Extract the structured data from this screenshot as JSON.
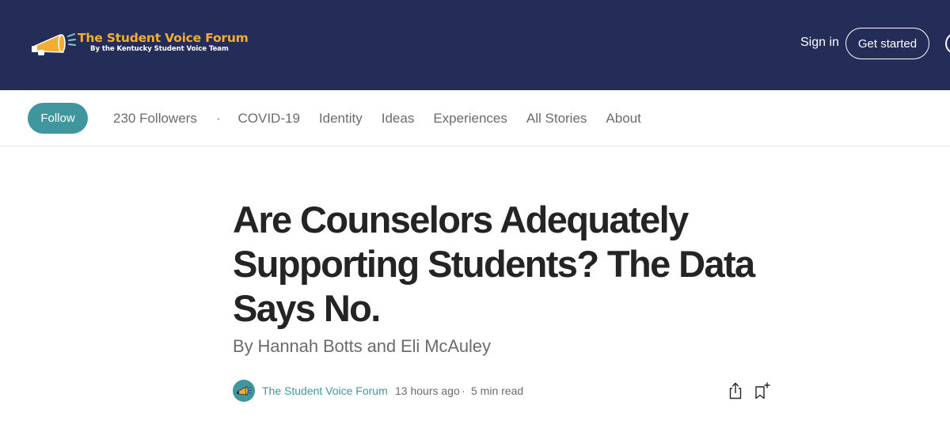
{
  "header": {
    "logo_title": "The Student Voice Forum",
    "logo_subtitle": "By the Kentucky Student Voice Team",
    "sign_in_label": "Sign in",
    "get_started_label": "Get started"
  },
  "publication_nav": {
    "follow_label": "Follow",
    "followers": "230 Followers",
    "separator": "·",
    "links": [
      "COVID-19",
      "Identity",
      "Ideas",
      "Experiences",
      "All Stories",
      "About"
    ]
  },
  "article": {
    "title": "Are Counselors Adequately Supporting Students? The Data Says No.",
    "subtitle": "By Hannah Botts and Eli McAuley",
    "publication_name": "The Student Voice Forum",
    "published": "13 hours ago",
    "separator": "·",
    "read_time": "5 min read"
  },
  "icons": {
    "logo": "megaphone-icon",
    "publication_avatar": "megaphone-icon",
    "share": "share-icon",
    "bookmark": "bookmark-add-icon"
  },
  "colors": {
    "header_bg": "#232d58",
    "logo_accent": "#f3ad33",
    "brand_teal": "#3f979d",
    "title_text": "#242424",
    "muted_text": "#6b6b6b"
  }
}
